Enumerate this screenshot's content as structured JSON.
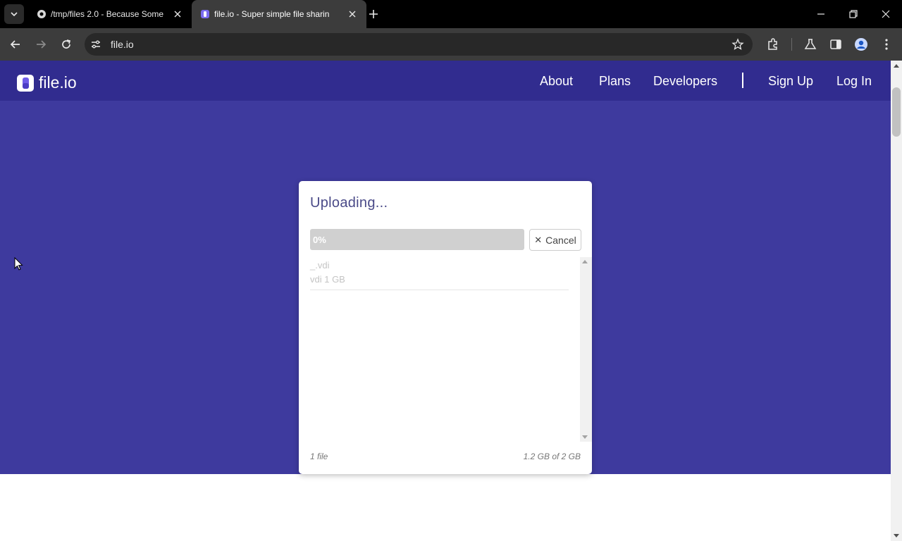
{
  "browser": {
    "tabs": [
      {
        "title": "/tmp/files 2.0 - Because Some",
        "active": false
      },
      {
        "title": "file.io - Super simple file sharin",
        "active": true
      }
    ],
    "url": "file.io"
  },
  "site": {
    "logo_text": "file.io",
    "nav": {
      "about": "About",
      "plans": "Plans",
      "developers": "Developers",
      "signup": "Sign Up",
      "login": "Log In"
    },
    "colors": {
      "navbar": "#312c8f",
      "hero": "#3e3a9e"
    }
  },
  "upload": {
    "title": "Uploading...",
    "progress_label": "0%",
    "progress_fraction": 0,
    "cancel_label": "Cancel",
    "files": [
      {
        "name": "_.vdi",
        "meta": "vdi 1 GB"
      }
    ],
    "footer_count": "1 file",
    "footer_quota": "1.2 GB of 2 GB"
  }
}
